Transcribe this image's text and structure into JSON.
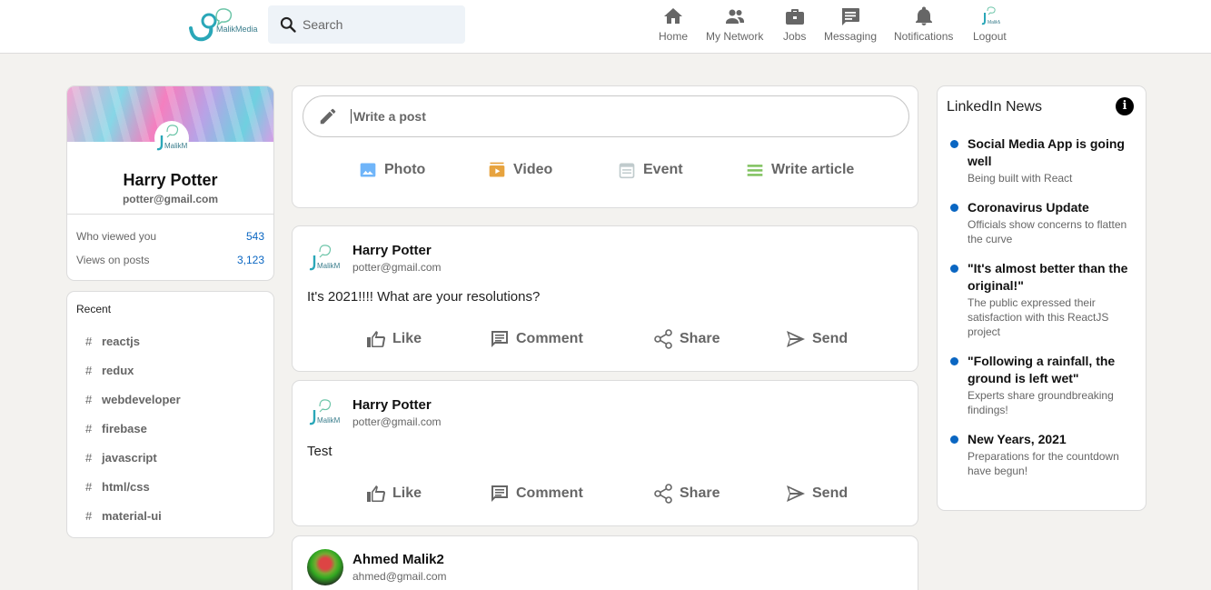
{
  "header": {
    "logo_text": "MalikMedia",
    "search_placeholder": "Search",
    "nav": [
      {
        "label": "Home",
        "icon": "home-icon"
      },
      {
        "label": "My Network",
        "icon": "network-icon"
      },
      {
        "label": "Jobs",
        "icon": "briefcase-icon"
      },
      {
        "label": "Messaging",
        "icon": "chat-icon"
      },
      {
        "label": "Notifications",
        "icon": "bell-icon"
      },
      {
        "label": "Logout",
        "icon": "avatar-logo"
      }
    ]
  },
  "profile": {
    "avatar_text": "MalikM",
    "name": "Harry Potter",
    "email": "potter@gmail.com",
    "stats": [
      {
        "label": "Who viewed you",
        "value": "543"
      },
      {
        "label": "Views on posts",
        "value": "3,123"
      }
    ]
  },
  "recent": {
    "title": "Recent",
    "items": [
      "reactjs",
      "redux",
      "webdeveloper",
      "firebase",
      "javascript",
      "html/css",
      "material-ui"
    ]
  },
  "composer": {
    "placeholder": "Write a post",
    "options": [
      {
        "label": "Photo",
        "icon": "photo-icon",
        "color": "#70b5f9"
      },
      {
        "label": "Video",
        "icon": "video-icon",
        "color": "#e7a33e"
      },
      {
        "label": "Event",
        "icon": "calendar-icon",
        "color": "#c0cbcd"
      },
      {
        "label": "Write article",
        "icon": "article-icon",
        "color": "#7fc15e"
      }
    ]
  },
  "posts": [
    {
      "avatar_text": "MalikM",
      "name": "Harry Potter",
      "email": "potter@gmail.com",
      "message": "It's 2021!!!! What are your resolutions?"
    },
    {
      "avatar_text": "MalikM",
      "name": "Harry Potter",
      "email": "potter@gmail.com",
      "message": "Test"
    },
    {
      "name": "Ahmed Malik2",
      "email": "ahmed@gmail.com"
    }
  ],
  "post_actions": [
    "Like",
    "Comment",
    "Share",
    "Send"
  ],
  "news": {
    "title": "LinkedIn News",
    "items": [
      {
        "heading": "Social Media App is going well",
        "subtitle": "Being built with React"
      },
      {
        "heading": "Coronavirus Update",
        "subtitle": "Officials show concerns to flatten the curve"
      },
      {
        "heading": "\"It's almost better than the original!\"",
        "subtitle": "The public expressed their satisfaction with this ReactJS project"
      },
      {
        "heading": "\"Following a rainfall, the ground is left wet\"",
        "subtitle": "Experts share groundbreaking findings!"
      },
      {
        "heading": "New Years, 2021",
        "subtitle": "Preparations for the countdown have begun!"
      }
    ]
  }
}
